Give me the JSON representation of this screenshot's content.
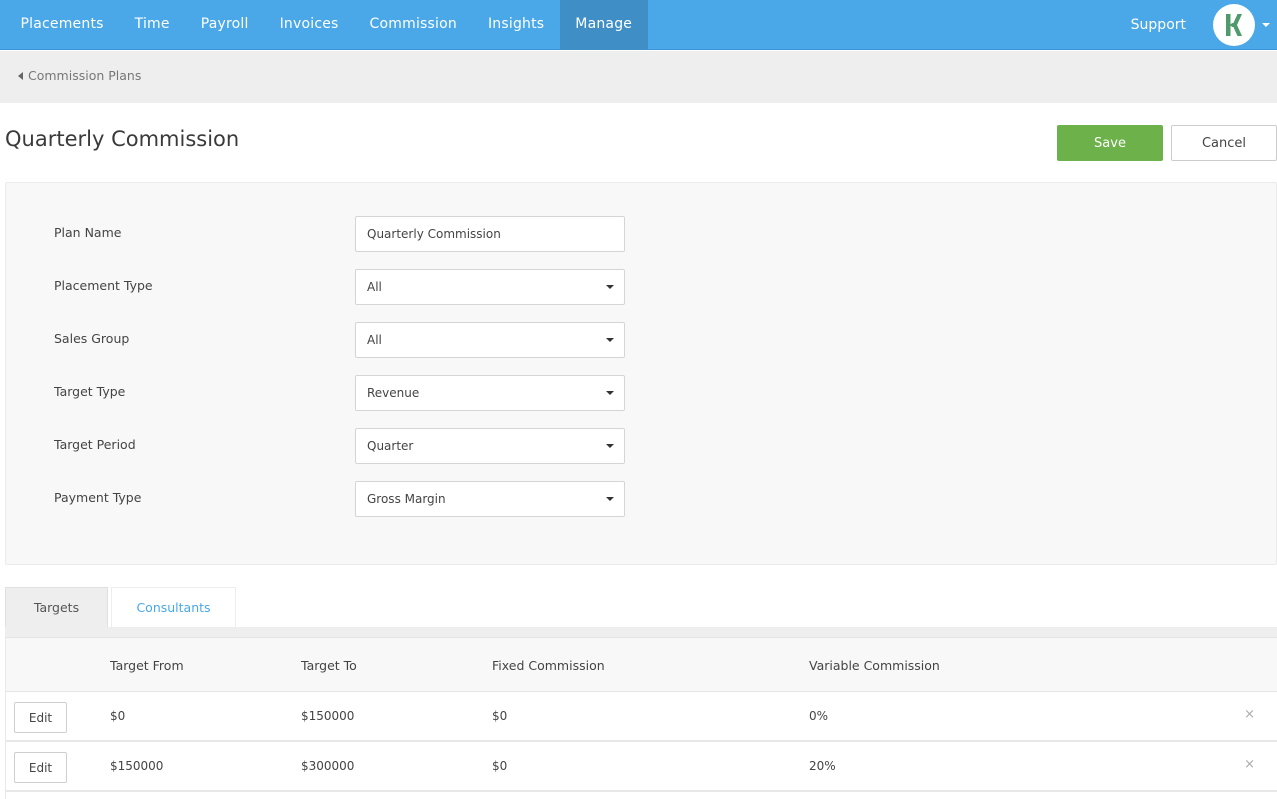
{
  "nav": {
    "items": [
      {
        "label": "Placements",
        "active": false
      },
      {
        "label": "Time",
        "active": false
      },
      {
        "label": "Payroll",
        "active": false
      },
      {
        "label": "Invoices",
        "active": false
      },
      {
        "label": "Commission",
        "active": false
      },
      {
        "label": "Insights",
        "active": false
      },
      {
        "label": "Manage",
        "active": true
      }
    ],
    "support_label": "Support",
    "avatar_icon": "k-logo-icon",
    "brand_color": "#4aa8e8"
  },
  "breadcrumb": {
    "back_label": "Commission Plans"
  },
  "header": {
    "title": "Quarterly Commission",
    "save_label": "Save",
    "cancel_label": "Cancel"
  },
  "form": {
    "fields": [
      {
        "label": "Plan Name",
        "type": "text",
        "value": "Quarterly Commission"
      },
      {
        "label": "Placement Type",
        "type": "select",
        "value": "All"
      },
      {
        "label": "Sales Group",
        "type": "select",
        "value": "All"
      },
      {
        "label": "Target Type",
        "type": "select",
        "value": "Revenue"
      },
      {
        "label": "Target Period",
        "type": "select",
        "value": "Quarter"
      },
      {
        "label": "Payment Type",
        "type": "select",
        "value": "Gross Margin"
      }
    ]
  },
  "tabs": [
    {
      "label": "Targets",
      "active": true
    },
    {
      "label": "Consultants",
      "active": false
    }
  ],
  "targets_table": {
    "columns": [
      "Target From",
      "Target To",
      "Fixed Commission",
      "Variable Commission"
    ],
    "edit_label": "Edit",
    "remove_icon": "×",
    "rows": [
      {
        "target_from": "$0",
        "target_to": "$150000",
        "fixed": "$0",
        "variable": "0%"
      },
      {
        "target_from": "$150000",
        "target_to": "$300000",
        "fixed": "$0",
        "variable": "20%"
      }
    ]
  }
}
